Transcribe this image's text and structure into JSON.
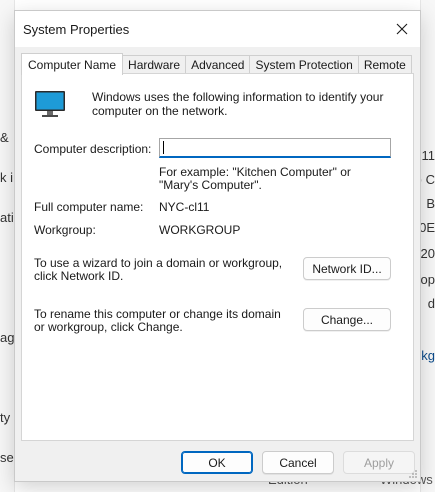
{
  "background": {
    "left_fragments": [
      "&",
      "k i",
      "ati",
      "ag",
      "ty",
      "se"
    ],
    "right_fragments": [
      "11",
      ") C",
      "B",
      "0E",
      "20",
      "op",
      "d",
      "kg"
    ],
    "bottom_fragments": [
      "Edition",
      "Windows"
    ]
  },
  "dialog": {
    "title": "System Properties",
    "tabs": [
      {
        "label": "Computer Name",
        "active": true
      },
      {
        "label": "Hardware",
        "active": false
      },
      {
        "label": "Advanced",
        "active": false
      },
      {
        "label": "System Protection",
        "active": false
      },
      {
        "label": "Remote",
        "active": false
      }
    ],
    "intro": "Windows uses the following information to identify your computer on the network.",
    "description": {
      "label": "Computer description:",
      "value": "",
      "example": "For example: \"Kitchen Computer\" or \"Mary's Computer\"."
    },
    "full_name": {
      "label": "Full computer name:",
      "value": "NYC-cl11"
    },
    "workgroup": {
      "label": "Workgroup:",
      "value": "WORKGROUP"
    },
    "network_id": {
      "text": "To use a wizard to join a domain or workgroup, click Network ID.",
      "button": "Network ID..."
    },
    "change": {
      "text": "To rename this computer or change its domain or workgroup, click Change.",
      "button": "Change..."
    },
    "footer": {
      "ok": "OK",
      "cancel": "Cancel",
      "apply": "Apply"
    }
  },
  "colors": {
    "accent": "#0067c0",
    "monitor_screen": "#1e9bd7"
  }
}
